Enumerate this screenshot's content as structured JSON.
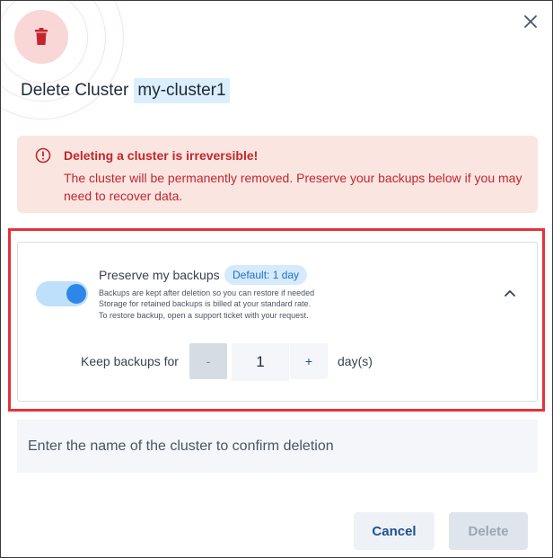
{
  "dialog": {
    "title": "Delete Cluster",
    "cluster_name": "my-cluster1",
    "icons": {
      "header": "trash-icon",
      "close": "close-icon"
    }
  },
  "alert": {
    "icon": "alert-circle-icon",
    "title": "Deleting a cluster is irreversible!",
    "body": "The cluster will be permanently removed. Preserve your backups below if you may need to recover data."
  },
  "backups": {
    "toggle_on": true,
    "label": "Preserve my backups",
    "badge": "Default: 1 day",
    "notes": [
      "Backups are kept after deletion so you can restore if needed",
      "Storage for retained backups is billed at your standard rate.",
      "To restore backup, open a support ticket with your request."
    ],
    "keep_label": "Keep backups for",
    "decrement_label": "-",
    "value": "1",
    "increment_label": "+",
    "unit": "day(s)",
    "collapse_icon": "chevron-up-icon"
  },
  "confirm": {
    "placeholder": "Enter the name of the cluster to confirm deletion"
  },
  "actions": {
    "cancel_label": "Cancel",
    "delete_label": "Delete"
  },
  "colors": {
    "danger": "#c1272d",
    "accent": "#2f86e9",
    "alert_bg": "#fbe5e1"
  }
}
